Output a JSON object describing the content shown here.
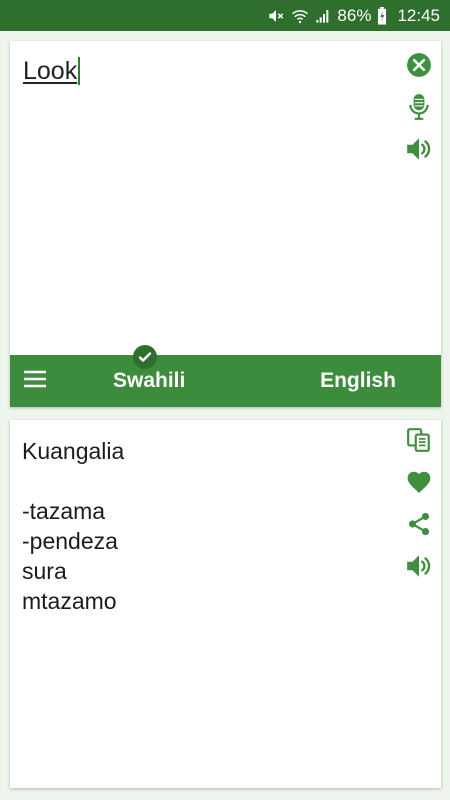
{
  "status_bar": {
    "battery": "86%",
    "time": "12:45",
    "icons": [
      "mute-icon",
      "wifi-icon",
      "signal-icon",
      "battery-charging-icon"
    ]
  },
  "input": {
    "text": "Look",
    "icons": [
      "clear-icon",
      "microphone-icon",
      "speaker-icon"
    ]
  },
  "language_bar": {
    "source": "Swahili",
    "target": "English",
    "icons": [
      "menu-icon",
      "check-icon"
    ]
  },
  "output": {
    "primary": "Kuangalia",
    "alternatives": [
      "-tazama",
      "-pendeza",
      "sura",
      "mtazamo"
    ],
    "icons": [
      "copy-icon",
      "favorite-heart-icon",
      "share-icon",
      "speaker-icon"
    ]
  },
  "colors": {
    "status_bar": "#2e6f2e",
    "accent": "#3d8b3d",
    "icon": "#3f8f3f",
    "background": "#eef5ec"
  }
}
